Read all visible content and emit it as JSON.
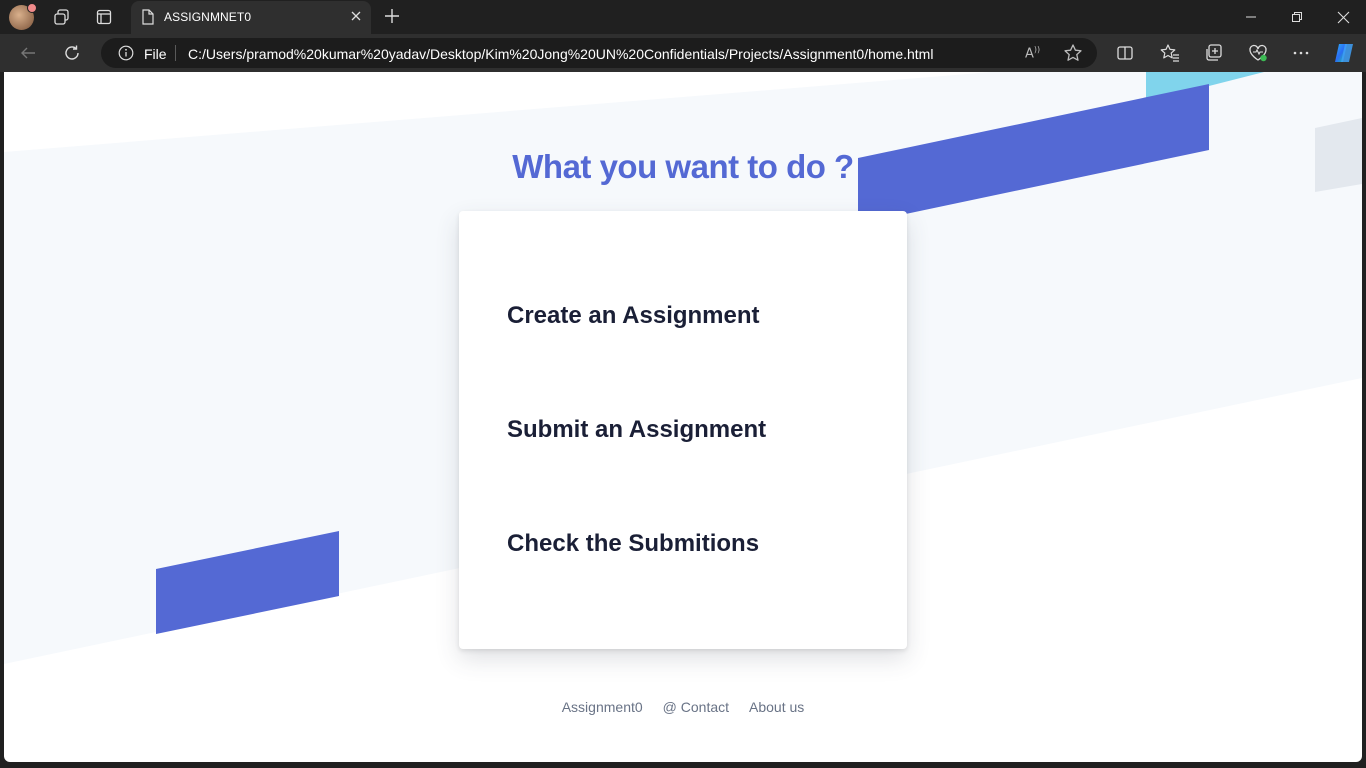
{
  "browser": {
    "tab_title": "ASSIGNMNET0",
    "address_scheme": "File",
    "url": "C:/Users/pramod%20kumar%20yadav/Desktop/Kim%20Jong%20UN%20Confidentials/Projects/Assignment0/home.html",
    "read_aloud_label": "A"
  },
  "page": {
    "heading": "What you want to do ?",
    "options": [
      "Create an Assignment",
      "Submit an Assignment",
      "Check the Submitions"
    ],
    "footer": {
      "brand": "Assignment0",
      "contact": "@ Contact",
      "about": "About us"
    }
  },
  "colors": {
    "accent": "#5469d4",
    "cyan_accent": "#80d4ec",
    "light_band": "#f6f9fc",
    "gray_block": "#e3e8ee",
    "text_dark": "#1a1f36",
    "text_muted": "#697386"
  },
  "icons": [
    "profile-avatar",
    "workspaces-icon",
    "tab-actions-icon",
    "page-icon",
    "close-icon",
    "plus-icon",
    "back-icon",
    "refresh-icon",
    "info-icon",
    "read-aloud-icon",
    "star-icon",
    "split-screen-icon",
    "favorites-icon",
    "collections-icon",
    "browser-essentials-icon",
    "more-icon",
    "copilot-icon",
    "minimize-icon",
    "restore-icon",
    "close-window-icon"
  ]
}
